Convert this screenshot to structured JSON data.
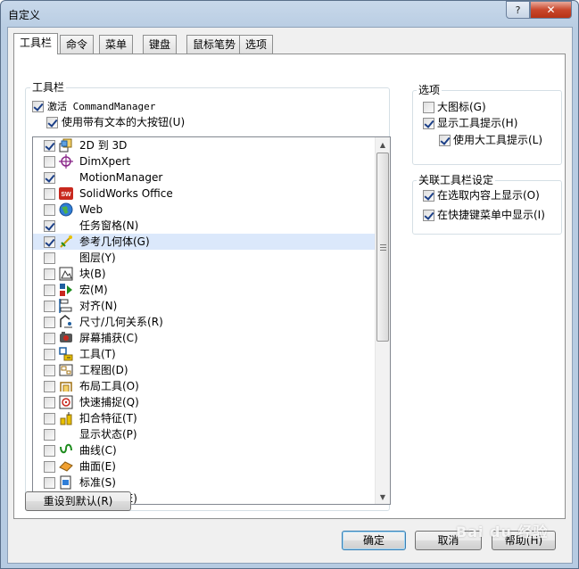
{
  "window": {
    "title": "自定义",
    "help_button": "?",
    "close_button": "✕"
  },
  "tabs": [
    {
      "label": "工具栏",
      "active": true
    },
    {
      "label": "命令"
    },
    {
      "label": "菜单"
    },
    {
      "label": "键盘"
    },
    {
      "label": "鼠标笔势"
    },
    {
      "label": "选项"
    }
  ],
  "toolbars_group": {
    "title": "工具栏",
    "activate_cm": {
      "label": "激活 CommandManager",
      "checked": true
    },
    "large_buttons": {
      "label": "使用带有文本的大按钮(U)",
      "checked": true
    },
    "items": [
      {
        "label": "2D 到 3D",
        "checked": true,
        "icon": "2d-to-3d-icon"
      },
      {
        "label": "DimXpert",
        "checked": false,
        "icon": "dimxpert-icon"
      },
      {
        "label": "MotionManager",
        "checked": true,
        "icon": ""
      },
      {
        "label": "SolidWorks Office",
        "checked": false,
        "icon": "solidworks-office-icon"
      },
      {
        "label": "Web",
        "checked": false,
        "icon": "globe-icon"
      },
      {
        "label": "任务窗格(N)",
        "checked": true,
        "icon": ""
      },
      {
        "label": "参考几何体(G)",
        "checked": true,
        "icon": "reference-geometry-icon",
        "selected": true
      },
      {
        "label": "图层(Y)",
        "checked": false,
        "icon": ""
      },
      {
        "label": "块(B)",
        "checked": false,
        "icon": "block-icon"
      },
      {
        "label": "宏(M)",
        "checked": false,
        "icon": "macro-icon"
      },
      {
        "label": "对齐(N)",
        "checked": false,
        "icon": "align-icon"
      },
      {
        "label": "尺寸/几何关系(R)",
        "checked": false,
        "icon": "dimension-relations-icon"
      },
      {
        "label": "屏幕捕获(C)",
        "checked": false,
        "icon": "screen-capture-icon"
      },
      {
        "label": "工具(T)",
        "checked": false,
        "icon": "tools-icon"
      },
      {
        "label": "工程图(D)",
        "checked": false,
        "icon": "drawing-icon"
      },
      {
        "label": "布局工具(O)",
        "checked": false,
        "icon": "layout-tools-icon"
      },
      {
        "label": "快速捕捉(Q)",
        "checked": false,
        "icon": "quick-snap-icon"
      },
      {
        "label": "扣合特征(T)",
        "checked": false,
        "icon": "fastening-features-icon"
      },
      {
        "label": "显示状态(P)",
        "checked": false,
        "icon": ""
      },
      {
        "label": "曲线(C)",
        "checked": false,
        "icon": "curves-icon"
      },
      {
        "label": "曲面(E)",
        "checked": false,
        "icon": "surfaces-icon"
      },
      {
        "label": "标准(S)",
        "checked": false,
        "icon": "standard-icon"
      },
      {
        "label": "标准视图(E)",
        "checked": false,
        "icon": "standard-views-icon"
      }
    ],
    "scroll_up": "▲",
    "scroll_down": "▼",
    "reset_button": "重设到默认(R)"
  },
  "options_group": {
    "title": "选项",
    "large_icons": {
      "label": "大图标(G)",
      "checked": false
    },
    "show_tooltips": {
      "label": "显示工具提示(H)",
      "checked": true
    },
    "large_tooltips": {
      "label": "使用大工具提示(L)",
      "checked": true
    }
  },
  "context_group": {
    "title": "关联工具栏设定",
    "show_on_selection": {
      "label": "在选取内容上显示(O)",
      "checked": true
    },
    "show_in_shortcut": {
      "label": "在快捷键菜单中显示(I)",
      "checked": true
    }
  },
  "footer": {
    "ok": "确定",
    "cancel": "取消",
    "help": "帮助(H)"
  },
  "watermark": "Bai du 经验"
}
